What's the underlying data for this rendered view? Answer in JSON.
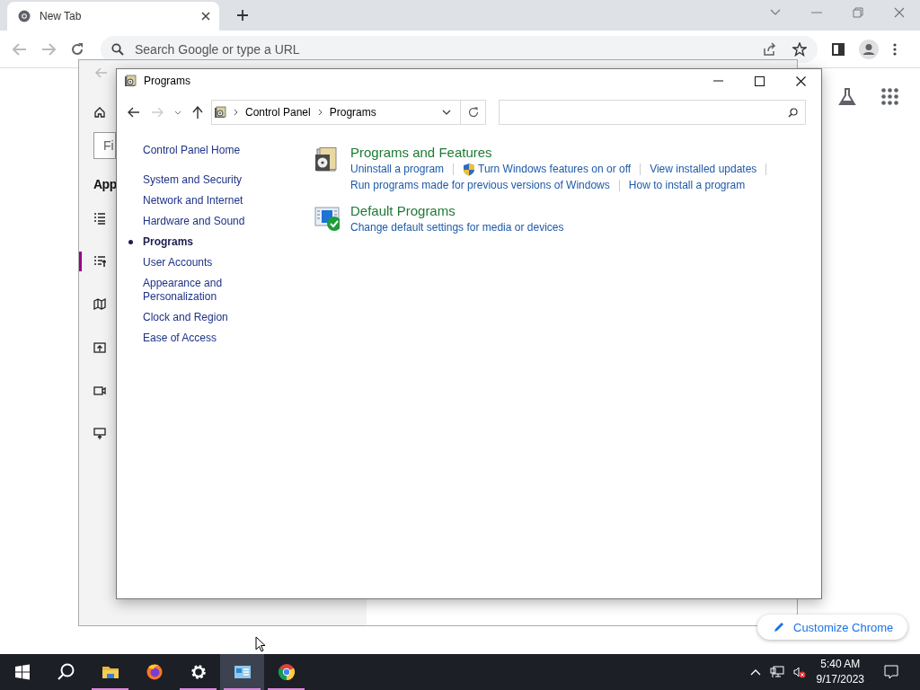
{
  "browser": {
    "tab_title": "New Tab",
    "address_placeholder": "Search Google or type a URL",
    "customize_button": "Customize Chrome"
  },
  "background_window": {
    "search_placeholder": "Fi",
    "heading": "App",
    "nav": [
      {
        "kind": "home",
        "selected": false
      },
      {
        "kind": "list",
        "selected": false
      },
      {
        "kind": "sorted-list",
        "selected": true
      },
      {
        "kind": "map",
        "selected": false
      },
      {
        "kind": "upload",
        "selected": false
      },
      {
        "kind": "video",
        "selected": false
      },
      {
        "kind": "presentation",
        "selected": false
      }
    ]
  },
  "control_panel": {
    "title": "Programs",
    "breadcrumb": [
      "Control Panel",
      "Programs"
    ],
    "sidebar": {
      "home": "Control Panel Home",
      "items": [
        {
          "label": "System and Security",
          "selected": false
        },
        {
          "label": "Network and Internet",
          "selected": false
        },
        {
          "label": "Hardware and Sound",
          "selected": false
        },
        {
          "label": "Programs",
          "selected": true
        },
        {
          "label": "User Accounts",
          "selected": false
        },
        {
          "label": "Appearance and Personalization",
          "selected": false
        },
        {
          "label": "Clock and Region",
          "selected": false
        },
        {
          "label": "Ease of Access",
          "selected": false
        }
      ]
    },
    "sections": [
      {
        "kind": "programs",
        "title": "Programs and Features",
        "link_rows": [
          [
            {
              "text": "Uninstall a program",
              "shield": false
            },
            {
              "text": "Turn Windows features on or off",
              "shield": true
            },
            {
              "text": "View installed updates",
              "shield": false
            }
          ],
          [
            {
              "text": "Run programs made for previous versions of Windows",
              "shield": false
            },
            {
              "text": "How to install a program",
              "shield": false
            }
          ]
        ]
      },
      {
        "kind": "defaults",
        "title": "Default Programs",
        "link_rows": [
          [
            {
              "text": "Change default settings for media or devices",
              "shield": false
            }
          ]
        ]
      }
    ]
  },
  "taskbar": {
    "apps": [
      {
        "kind": "start",
        "running": false,
        "active": false
      },
      {
        "kind": "search",
        "running": false,
        "active": false
      },
      {
        "kind": "explorer",
        "running": true,
        "active": false
      },
      {
        "kind": "firefox",
        "running": false,
        "active": false
      },
      {
        "kind": "settings",
        "running": true,
        "active": false
      },
      {
        "kind": "control-panel",
        "running": true,
        "active": true
      },
      {
        "kind": "chrome",
        "running": true,
        "active": false
      }
    ],
    "time": "5:40 AM",
    "date": "9/17/2023"
  }
}
